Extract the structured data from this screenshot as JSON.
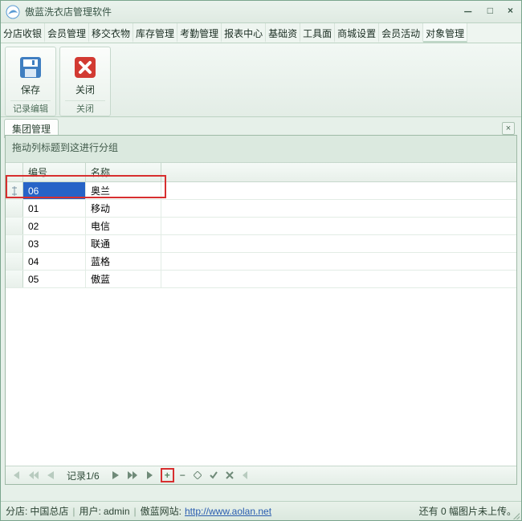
{
  "window": {
    "title": "傲蓝洗衣店管理软件"
  },
  "menu": {
    "items": [
      "分店收银",
      "会员管理",
      "移交衣物",
      "库存管理",
      "考勤管理",
      "报表中心",
      "基础资",
      "工具面",
      "商城设置",
      "会员活动",
      "对象管理"
    ],
    "active_index": 10
  },
  "ribbon": {
    "groups": [
      {
        "caption": "记录编辑",
        "buttons": [
          {
            "id": "save",
            "label": "保存",
            "icon": "save-icon"
          }
        ]
      },
      {
        "caption": "关闭",
        "buttons": [
          {
            "id": "close",
            "label": "关闭",
            "icon": "close-x-icon"
          }
        ]
      }
    ]
  },
  "tabs": {
    "items": [
      "集团管理"
    ],
    "active_index": 0
  },
  "grid": {
    "group_hint": "拖动列标题到这进行分组",
    "columns": [
      "编号",
      "名称"
    ],
    "rows": [
      {
        "id": "06",
        "name": "奥兰",
        "editing": true
      },
      {
        "id": "01",
        "name": "移动"
      },
      {
        "id": "02",
        "name": "电信"
      },
      {
        "id": "03",
        "name": "联通"
      },
      {
        "id": "04",
        "name": "蓝格"
      },
      {
        "id": "05",
        "name": "傲蓝"
      }
    ],
    "selected_index": 0
  },
  "navigator": {
    "record_label": "记录1/6"
  },
  "status": {
    "store_label": "分店:",
    "store_value": "中国总店",
    "user_label": "用户:",
    "user_value": "admin",
    "site_label": "傲蓝网站:",
    "site_url": "http://www.aolan.net",
    "right_text": "还有 0 幅图片未上传。"
  },
  "colors": {
    "accent": "#2763c7",
    "highlight": "#d72f2f",
    "surface": "#e6f0e9"
  }
}
